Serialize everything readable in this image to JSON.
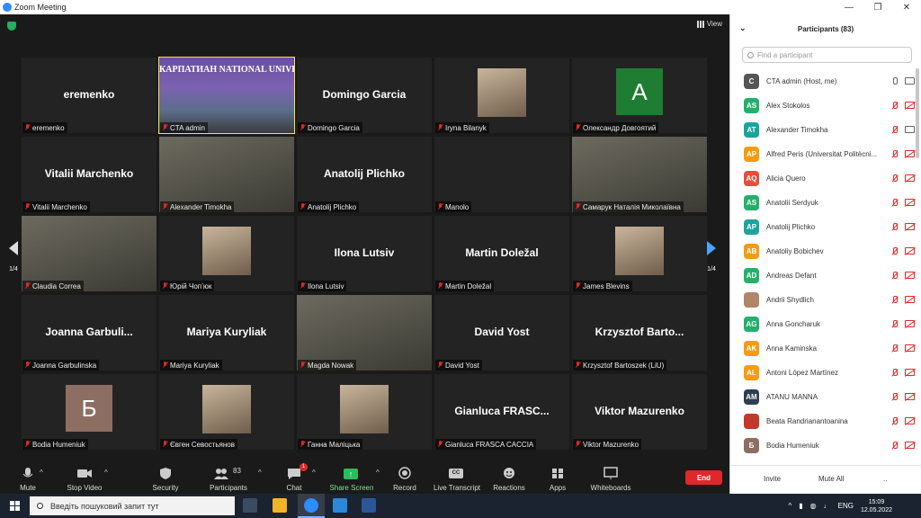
{
  "window": {
    "title": "Zoom Meeting"
  },
  "meeting": {
    "view_label": "View",
    "page_indicator": "1/4",
    "tiles": [
      {
        "big_name": "eremenko",
        "label": "eremenko",
        "type": "name"
      },
      {
        "big_name": "",
        "label": "CTA admin",
        "type": "video",
        "active": true,
        "banner_text": "КАРПАТИАН NATIONAL UNIVE"
      },
      {
        "big_name": "Domingo Garcia",
        "label": "Domingo Garcia",
        "type": "name"
      },
      {
        "big_name": "",
        "label": "Iryna Bilanyk",
        "type": "photo"
      },
      {
        "big_name": "",
        "label": "Олександр Довгоятий",
        "type": "letter",
        "letter": "A",
        "color": "#1e7d32"
      },
      {
        "big_name": "Vitalii Marchenko",
        "label": "Vitalii Marchenko",
        "type": "name"
      },
      {
        "big_name": "",
        "label": "Alexander Timokha",
        "type": "video"
      },
      {
        "big_name": "Anatolij Plichko",
        "label": "Anatolij Plichko",
        "type": "name"
      },
      {
        "big_name": "",
        "label": "Manolo",
        "type": "blank"
      },
      {
        "big_name": "",
        "label": "Самарук Наталія Миколаївна",
        "type": "video"
      },
      {
        "big_name": "",
        "label": "Claudia Correa",
        "type": "video"
      },
      {
        "big_name": "",
        "label": "Юрій Чопʼюк",
        "type": "photo"
      },
      {
        "big_name": "Ilona Lutsiv",
        "label": "Ilona Lutsiv",
        "type": "name"
      },
      {
        "big_name": "Martin Doležal",
        "label": "Martin Doležal",
        "type": "name"
      },
      {
        "big_name": "",
        "label": "James Blevins",
        "type": "photo"
      },
      {
        "big_name": "Joanna Garbuli...",
        "label": "Joanna Garbulinska",
        "type": "name"
      },
      {
        "big_name": "Mariya Kuryliak",
        "label": "Mariya Kuryliak",
        "type": "name"
      },
      {
        "big_name": "",
        "label": "Magda Nowak",
        "type": "video"
      },
      {
        "big_name": "David Yost",
        "label": "David Yost",
        "type": "name"
      },
      {
        "big_name": "Krzysztof Barto...",
        "label": "Krzysztof Bartoszek (LiU)",
        "type": "name"
      },
      {
        "big_name": "",
        "label": "Bodia Humeniuk",
        "type": "letter",
        "letter": "Б",
        "color": "#8d6e63"
      },
      {
        "big_name": "",
        "label": "Євген Севостьянов",
        "type": "photo"
      },
      {
        "big_name": "",
        "label": "Ганна Маліцька",
        "type": "photo"
      },
      {
        "big_name": "Gianluca FRASC...",
        "label": "Gianluca FRASCA CACCIA",
        "type": "name"
      },
      {
        "big_name": "Viktor Mazurenko",
        "label": "Viktor Mazurenko",
        "type": "name"
      }
    ]
  },
  "toolbar": {
    "mute": "Mute",
    "stop_video": "Stop Video",
    "security": "Security",
    "participants": "Participants",
    "participants_count": "83",
    "chat": "Chat",
    "chat_badge": "1",
    "share_screen": "Share Screen",
    "record": "Record",
    "live_transcript": "Live Transcript",
    "reactions": "Reactions",
    "apps": "Apps",
    "whiteboards": "Whiteboards",
    "end": "End",
    "cc_text": "CC"
  },
  "panel": {
    "title": "Participants (83)",
    "search_placeholder": "Find a participant",
    "invite": "Invite",
    "mute_all": "Mute All",
    "more": "..",
    "participants": [
      {
        "initials": "C",
        "name": "CTA admin (Host, me)",
        "color": "#555",
        "mic_on": true,
        "cam_on": true
      },
      {
        "initials": "AS",
        "name": "Alex Stokolos",
        "color": "#23b06a",
        "mic_on": false,
        "cam_on": false
      },
      {
        "initials": "AT",
        "name": "Alexander Timokha",
        "color": "#1ba39c",
        "mic_on": false,
        "cam_on": true
      },
      {
        "initials": "AP",
        "name": "Alfred Peris (Universitat Politècni...",
        "color": "#f39c12",
        "mic_on": false,
        "cam_on": false
      },
      {
        "initials": "AQ",
        "name": "Alicia Quero",
        "color": "#e74c3c",
        "mic_on": false,
        "cam_on": false
      },
      {
        "initials": "AS",
        "name": "Anatolii Serdyuk",
        "color": "#23b06a",
        "mic_on": false,
        "cam_on": false
      },
      {
        "initials": "AP",
        "name": "Anatolij Plichko",
        "color": "#1ba39c",
        "mic_on": false,
        "cam_on": false
      },
      {
        "initials": "AB",
        "name": "Anatoliy Bobichev",
        "color": "#f39c12",
        "mic_on": false,
        "cam_on": false
      },
      {
        "initials": "AD",
        "name": "Andreas Defant",
        "color": "#23b06a",
        "mic_on": false,
        "cam_on": false
      },
      {
        "initials": "",
        "name": "Andrii Shydlich",
        "color": "#b0856a",
        "mic_on": false,
        "cam_on": false
      },
      {
        "initials": "AG",
        "name": "Anna Goncharuk",
        "color": "#23b06a",
        "mic_on": false,
        "cam_on": false
      },
      {
        "initials": "AK",
        "name": "Anna Kaminska",
        "color": "#f39c12",
        "mic_on": false,
        "cam_on": false
      },
      {
        "initials": "AL",
        "name": "Antoni López Martínez",
        "color": "#f39c12",
        "mic_on": false,
        "cam_on": false
      },
      {
        "initials": "AM",
        "name": "ATANU MANNA",
        "color": "#2c3e50",
        "mic_on": false,
        "cam_on": false
      },
      {
        "initials": "",
        "name": "Beata Randrianantoanina",
        "color": "#c0392b",
        "mic_on": false,
        "cam_on": false
      },
      {
        "initials": "Б",
        "name": "Bodia Humeniuk",
        "color": "#8d6e63",
        "mic_on": false,
        "cam_on": false
      }
    ]
  },
  "taskbar": {
    "search_placeholder": "Введіть пошуковий запит тут",
    "language": "ENG",
    "time": "15:09",
    "date": "12.05.2022"
  }
}
